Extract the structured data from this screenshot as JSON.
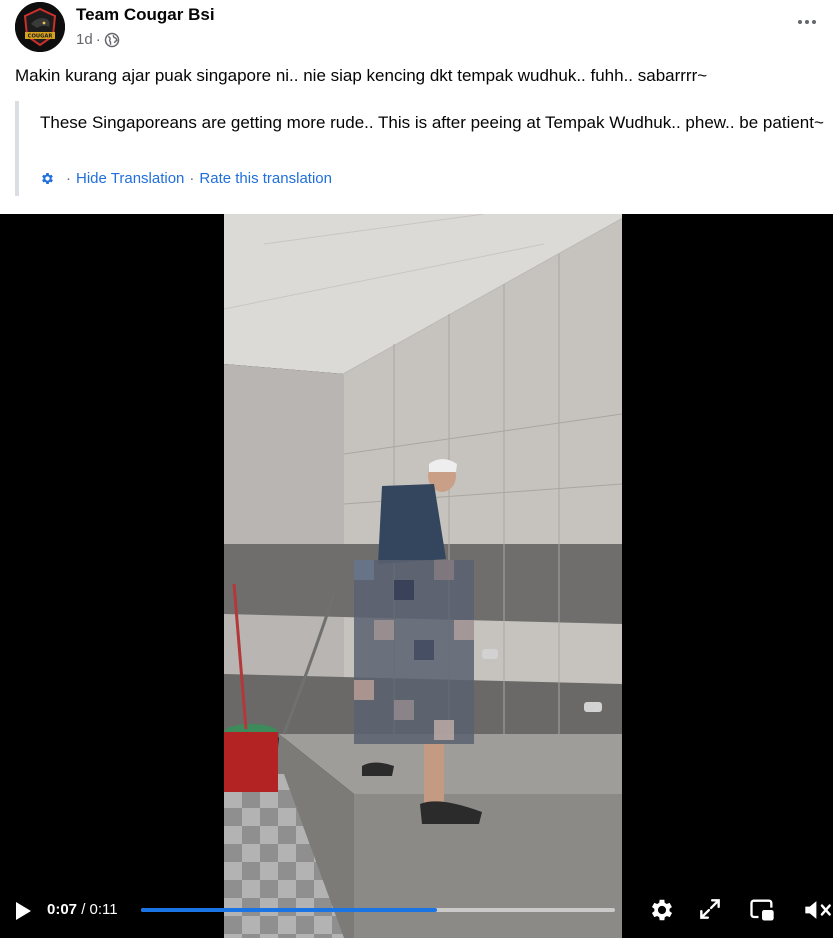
{
  "post": {
    "author": "Team Cougar Bsi",
    "time": "1d",
    "separator": "·",
    "avatar_text": "COUGAR",
    "original_text": "Makin kurang ajar puak singapore ni.. nie siap kencing dkt tempak wudhuk.. fuhh.. sabarrrr~",
    "translation_text": "These Singaporeans are getting more rude.. This is after peeing at Tempak Wudhuk.. phew.. be patient~",
    "hide_translation": "Hide Translation",
    "dot": "·",
    "rate_translation": "Rate this translation",
    "more_icon": "more-options-icon",
    "privacy_icon": "globe-icon"
  },
  "video": {
    "current_time": "0:07",
    "time_divider": " / ",
    "total_time": "0:11",
    "progress": 0.625,
    "accent": "#1b74e4",
    "icons": [
      "play-icon",
      "settings-gear-icon",
      "fullscreen-icon",
      "picture-in-picture-icon",
      "muted-volume-icon"
    ]
  },
  "colors": {
    "link": "#216fdb",
    "muted": "#65676b",
    "quote_bar": "#dadde1"
  }
}
